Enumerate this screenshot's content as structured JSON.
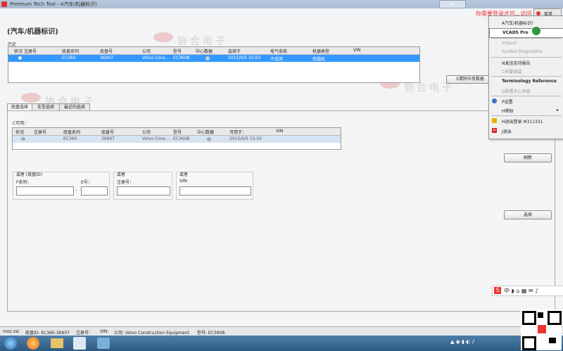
{
  "window": {
    "title": "Premium Tech Tool - A汽车/机器标识)"
  },
  "overlay_label": "你需要登录才可...访问",
  "menu_button": {
    "label": "菜单"
  },
  "page": {
    "title": "(汽车/机器标识)"
  },
  "recent": {
    "label": "历史",
    "columns": [
      "状况",
      "注册号",
      "底盘系列",
      "底盘号",
      "公司",
      "型号",
      "中心数据",
      "选择于",
      "电气系统",
      "机器类型",
      "VIN"
    ],
    "rows": [
      [
        "",
        "",
        "EC360",
        "36907",
        "Volvo Cons...",
        "EC360B",
        "",
        "2015/9/5 15:03",
        "不适用",
        "挖掘机",
        ""
      ]
    ],
    "clear_button": "S清除中央数据"
  },
  "tabs": [
    "底盘选择",
    "车型选择",
    "最近的选择"
  ],
  "available": {
    "label": "C可用：",
    "columns": [
      "状况",
      "注册号",
      "底盘系列",
      "底盘号",
      "公司",
      "型号",
      "中心数据",
      "可用于：",
      "VIN"
    ],
    "rows": [
      [
        "",
        "",
        "EC360",
        "36907",
        "Volvo Cons...",
        "EC360B",
        "",
        "2015/9/5 15:02",
        ""
      ]
    ],
    "refresh_button": "刷新"
  },
  "fields": {
    "chassis": {
      "group": "或者 (底盘ID)",
      "series_label": "F系列：",
      "dash": "-",
      "number_label": "E号：",
      "series_value": "",
      "number_value": ""
    },
    "reg": {
      "group": "或者",
      "label": "注册号：",
      "value": ""
    },
    "vin": {
      "group": "或者",
      "label": "VIN:",
      "value": ""
    }
  },
  "select_button": "选择",
  "context_menu": {
    "items": [
      "A汽车/机器标识)",
      "VCADS Pro",
      "Impact",
      "Guided Diagnostics",
      "N发送支持报告",
      "C将要调谐",
      "Terminology Reference",
      "D配置中心系统",
      "P设置",
      "H帮助",
      "H退出登录 M311331",
      "J退出"
    ],
    "disabled": [
      false,
      false,
      true,
      true,
      false,
      true,
      false,
      true,
      false,
      false,
      false,
      false
    ]
  },
  "statusbar": {
    "user": "moz.zai",
    "chassis_id": "底盘ID: EC360-36907",
    "reg": "注册号：",
    "vin": "VIN:",
    "company": "公司: Volvo Construction Equipment",
    "model": "型号: EC360B"
  },
  "watermark": "协合电子",
  "colors": {
    "selected_row": "#3399ff",
    "title_bar": "#b0c4da",
    "accent_red": "#e33333"
  }
}
